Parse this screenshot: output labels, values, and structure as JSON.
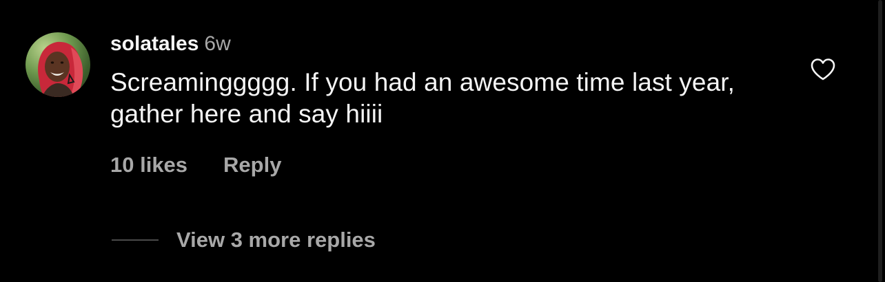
{
  "comment": {
    "username": "solatales",
    "timestamp": "6w",
    "text": "Screaminggggg. If you had an awesome time last year, gather here and say hiiii",
    "likes": "10 likes",
    "reply_label": "Reply",
    "view_replies_label": "View 3 more replies"
  },
  "icons": {
    "like": "heart-outline-icon",
    "avatar": "profile-photo"
  },
  "colors": {
    "background": "#000000",
    "primary_text": "#f5f5f5",
    "secondary_text": "#a8a8a8",
    "divider_line": "#4a4a4a"
  }
}
